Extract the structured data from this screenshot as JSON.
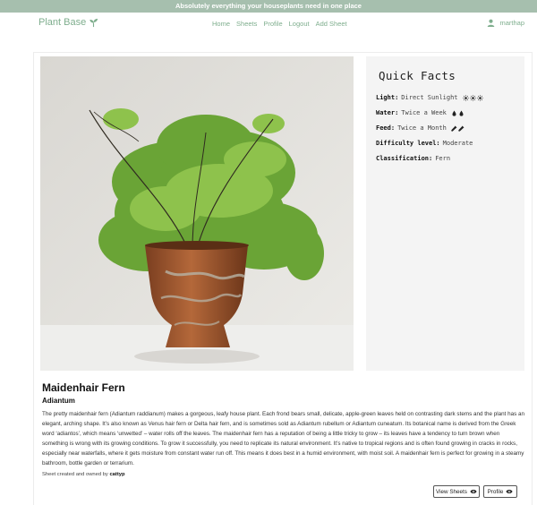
{
  "banner": {
    "text": "Absolutely everything your houseplants need in one place"
  },
  "nav": {
    "brand": "Plant Base",
    "links": [
      "Home",
      "Sheets",
      "Profile",
      "Logout",
      "Add Sheet"
    ],
    "username": "marthap"
  },
  "facts": {
    "heading": "Quick Facts",
    "items": [
      {
        "label": "Light:",
        "value": "Direct Sunlight",
        "icon": "sun-icon",
        "icon_count": 3
      },
      {
        "label": "Water:",
        "value": "Twice a Week",
        "icon": "water-drop-icon",
        "icon_count": 2
      },
      {
        "label": "Feed:",
        "value": "Twice a Month",
        "icon": "dropper-icon",
        "icon_count": 2
      },
      {
        "label": "Difficulty level:",
        "value": "Moderate"
      },
      {
        "label": "Classification:",
        "value": "Fern"
      }
    ]
  },
  "plant": {
    "name": "Maidenhair Fern",
    "latin": "Adiantum",
    "description": "The pretty maidenhair fern (Adiantum raddianum) makes a gorgeous, leafy house plant. Each frond bears small, delicate, apple-green leaves held on contrasting dark stems and the plant has an elegant, arching shape. It’s also known as Venus hair fern or Delta hair fern, and is sometimes sold as Adiantum rubellum or Adiantum cuneatum. Its botanical name is derived from the Greek word ‘adiantos’, which means ‘unwetted’ – water rolls off the leaves. The maidenhair fern has a reputation of being a little tricky to grow – its leaves have a tendency to turn brown when something is wrong with its growing conditions. To grow it successfully, you need to replicate its natural environment. It’s native to tropical regions and is often found growing in cracks in rocks, especially near waterfalls, where it gets moisture from constant water run off. This means it does best in a humid environment, with moist soil. A maidenhair fern is perfect for growing in a steamy bathroom, bottle garden or terrarium."
  },
  "owner": {
    "prefix": "Sheet created and owned by",
    "username": "cattyp"
  },
  "buttons": {
    "view_sheets": "View Sheets",
    "profile": "Profile"
  },
  "colors": {
    "accent": "#7fae8e",
    "banner": "#a6bfae"
  }
}
